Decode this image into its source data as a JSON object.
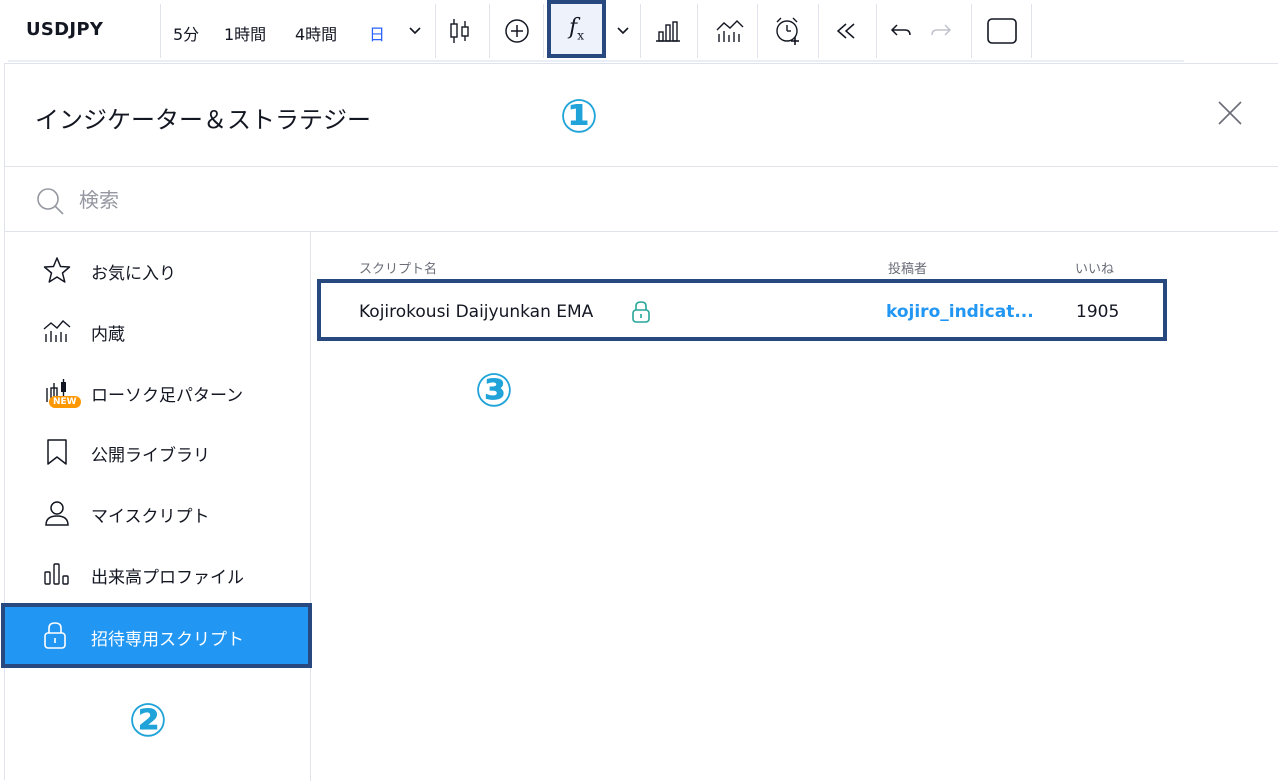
{
  "toolbar": {
    "symbol": "USDJPY",
    "intervals": [
      "5分",
      "1時間",
      "4時間",
      "日"
    ],
    "active_interval": "日"
  },
  "dialog": {
    "title": "インジケーター＆ストラテジー",
    "search_placeholder": "検索"
  },
  "sidebar": {
    "items": [
      {
        "label": "お気に入り",
        "icon": "star-icon"
      },
      {
        "label": "内蔵",
        "icon": "chart-icon"
      },
      {
        "label": "ローソク足パターン",
        "icon": "candle-icon",
        "badge": "NEW"
      },
      {
        "label": "公開ライブラリ",
        "icon": "bookmark-icon"
      },
      {
        "label": "マイスクリプト",
        "icon": "user-icon"
      },
      {
        "label": "出来高プロファイル",
        "icon": "bars-icon"
      },
      {
        "label": "招待専用スクリプト",
        "icon": "lock-icon",
        "active": true
      }
    ]
  },
  "table": {
    "headers": {
      "name": "スクリプト名",
      "author": "投稿者",
      "likes": "いいね"
    },
    "rows": [
      {
        "name": "Kojirokousi Daijyunkan EMA",
        "author": "kojiro_indicat...",
        "likes": "1905"
      }
    ]
  },
  "callouts": [
    "①",
    "②",
    "③"
  ],
  "colors": {
    "accent": "#2196f3",
    "highlight_border": "#27497f",
    "callout": "#1fa3d8",
    "badge": "#ff9800"
  }
}
